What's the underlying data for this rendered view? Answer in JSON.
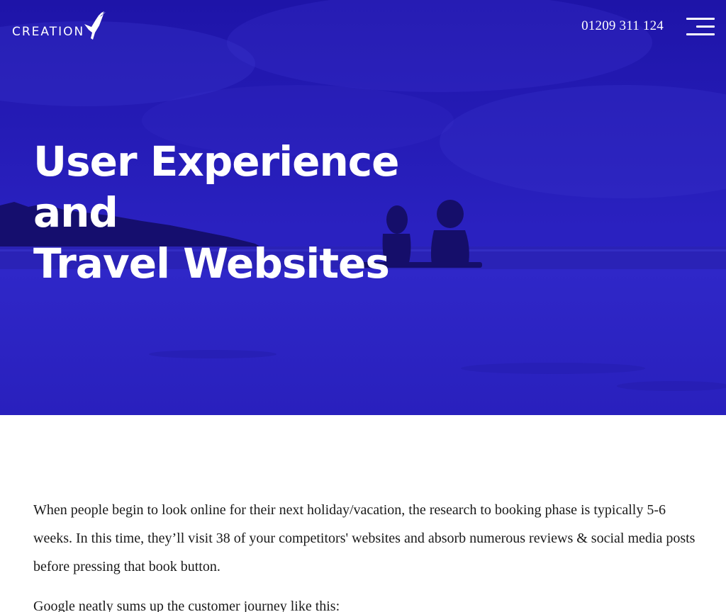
{
  "header": {
    "logo_text": "CREATION",
    "phone": "01209 311 124",
    "menu_icon": "hamburger-menu-icon"
  },
  "hero": {
    "title_line1": "User Experience and",
    "title_line2": "Travel Websites",
    "overlay_color": "#2018b8"
  },
  "article": {
    "paragraph1": "When people begin to look online for their next holiday/vacation, the research to booking phase is typically 5-6 weeks. In this time, they’ll visit 38 of your competitors' websites and absorb numerous reviews & social media posts before pressing that book button.",
    "paragraph2": "Google neatly sums up the customer journey like this:"
  },
  "colors": {
    "accent": "#2018b8",
    "text": "#1a1a1a",
    "background": "#ffffff"
  }
}
